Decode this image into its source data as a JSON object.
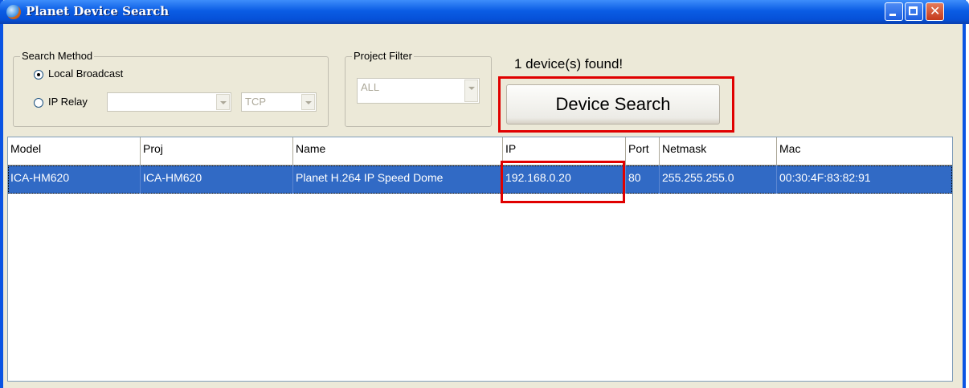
{
  "window": {
    "title": "Planet Device Search"
  },
  "search_method": {
    "label": "Search Method",
    "option_local": "Local Broadcast",
    "option_relay": "IP Relay",
    "relay_address": "",
    "protocol": "TCP"
  },
  "project_filter": {
    "label": "Project Filter",
    "value": "ALL"
  },
  "status_text": "1 device(s) found!",
  "search_button": "Device Search",
  "table": {
    "columns": [
      "Model",
      "Proj",
      "Name",
      "IP",
      "Port",
      "Netmask",
      "Mac"
    ],
    "rows": [
      [
        "ICA-HM620",
        "ICA-HM620",
        "Planet H.264 IP Speed Dome",
        "192.168.0.20",
        "80",
        "255.255.255.0",
        "00:30:4F:83:82:91"
      ]
    ]
  },
  "colors": {
    "selection": "#316ac5",
    "highlight": "#e00000",
    "titlebar": "#0a5ce4"
  }
}
